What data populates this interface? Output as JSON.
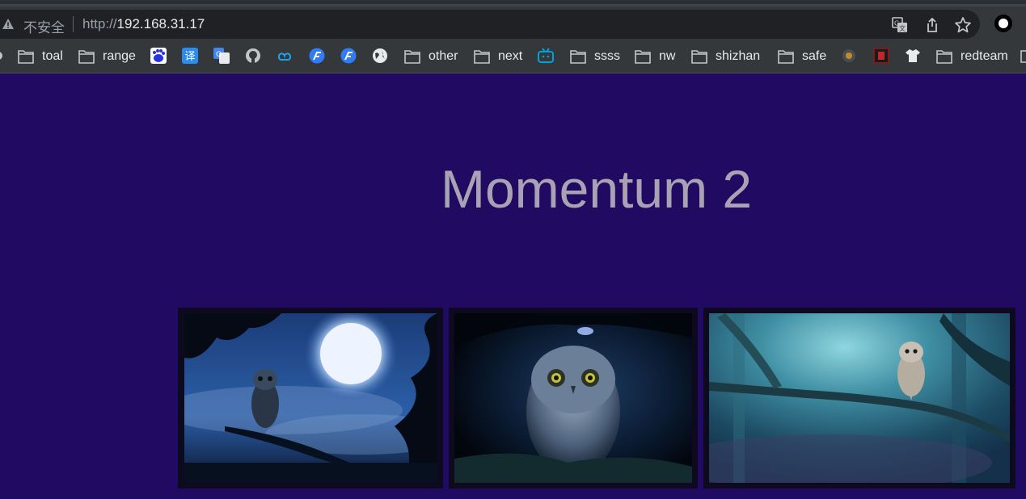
{
  "browser": {
    "insecure_label": "不安全",
    "url_scheme": "http://",
    "url_host": "192.168.31.17"
  },
  "bookmarks": {
    "toal": "toal",
    "range": "range",
    "other": "other",
    "next": "next",
    "ssss": "ssss",
    "nw": "nw",
    "shizhan": "shizhan",
    "safe": "safe",
    "redteam": "redteam",
    "translate_glyph": "译"
  },
  "page": {
    "title": "Momentum 2",
    "background": "#200a62"
  },
  "gallery": [
    {
      "subject": "owl on branch under full moon"
    },
    {
      "subject": "owl in dark cave"
    },
    {
      "subject": "owl perched on mossy branch"
    }
  ]
}
